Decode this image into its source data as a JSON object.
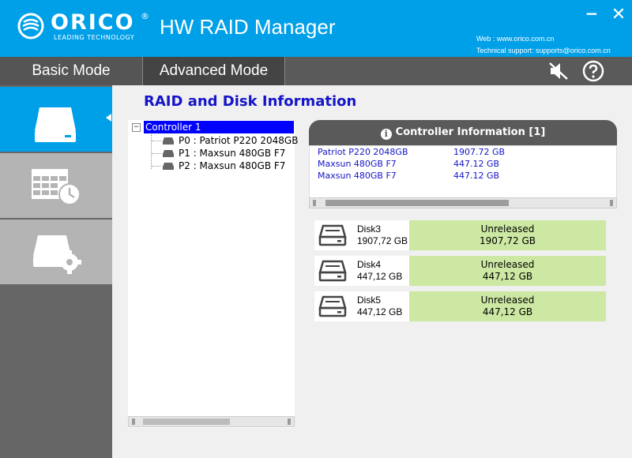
{
  "header": {
    "logo_text": "ORICO",
    "logo_reg": "®",
    "logo_tagline": "LEADING TECHNOLOGY",
    "app_title": "HW RAID Manager",
    "minimize_label": "−",
    "close_label": "✕",
    "web_line": "Web : www.orico.com.cn",
    "support_line": "Technical support: supports@orico.com.cn"
  },
  "modes": {
    "basic": "Basic Mode",
    "advanced": "Advanced Mode"
  },
  "page": {
    "title": "RAID and Disk Information"
  },
  "tree": {
    "expand_glyph": "−",
    "root": "Controller 1",
    "items": [
      "P0 : Patriot P220 2048GB",
      "P1 : Maxsun  480GB F7",
      "P2 : Maxsun  480GB F7"
    ]
  },
  "controller": {
    "info_glyph": "i",
    "header": "Controller Information  [1]",
    "rows": [
      {
        "model": "Patriot P220 2048GB",
        "capacity": "1907.72 GB"
      },
      {
        "model": "Maxsun  480GB F7",
        "capacity": "447.12 GB"
      },
      {
        "model": "Maxsun  480GB F7",
        "capacity": "447.12 GB"
      }
    ]
  },
  "disks": [
    {
      "name": "Disk3",
      "size": "1907,72 GB",
      "status": "Unreleased",
      "status_size": "1907,72 GB"
    },
    {
      "name": "Disk4",
      "size": "447,12 GB",
      "status": "Unreleased",
      "status_size": "447,12 GB"
    },
    {
      "name": "Disk5",
      "size": "447,12 GB",
      "status": "Unreleased",
      "status_size": "447,12 GB"
    }
  ],
  "colors": {
    "header_blue": "#00a0e9",
    "title_blue": "#1414c8",
    "status_green": "#cce8a2",
    "sidebar_gray": "#666666"
  },
  "icons": {
    "sound": "speaker-muted-icon",
    "help": "question-circle-icon",
    "raid": "hard-drive-icon",
    "task": "grid-clock-icon",
    "settings": "drive-gear-icon"
  }
}
